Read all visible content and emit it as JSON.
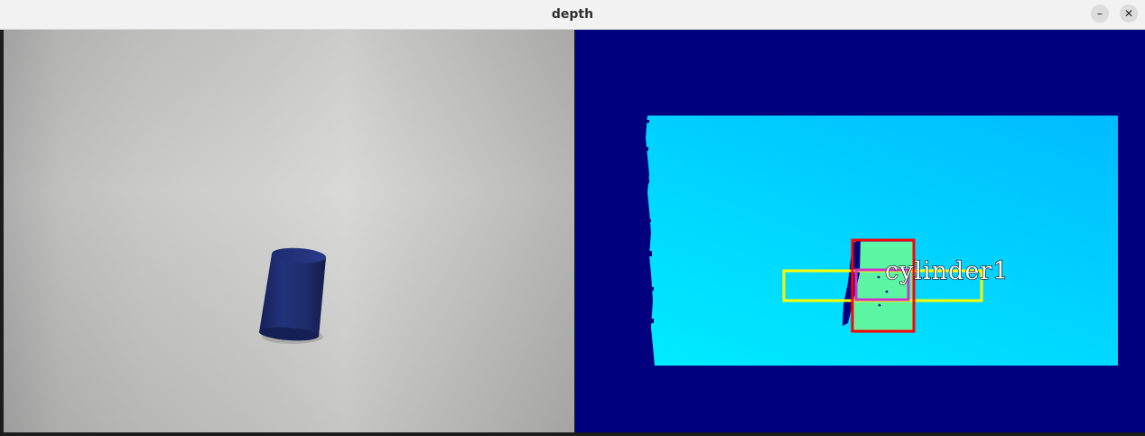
{
  "window": {
    "title": "depth",
    "minimize_glyph": "–",
    "close_glyph": "✕"
  },
  "rgb_view": {
    "object_color": "#1b2a6b"
  },
  "depth_view": {
    "background_color": "#00007f",
    "detection_label": "cylinder1",
    "box_colors": {
      "outer": "#ff0000",
      "wide": "#ffff00",
      "inner": "#cc33cc"
    }
  }
}
